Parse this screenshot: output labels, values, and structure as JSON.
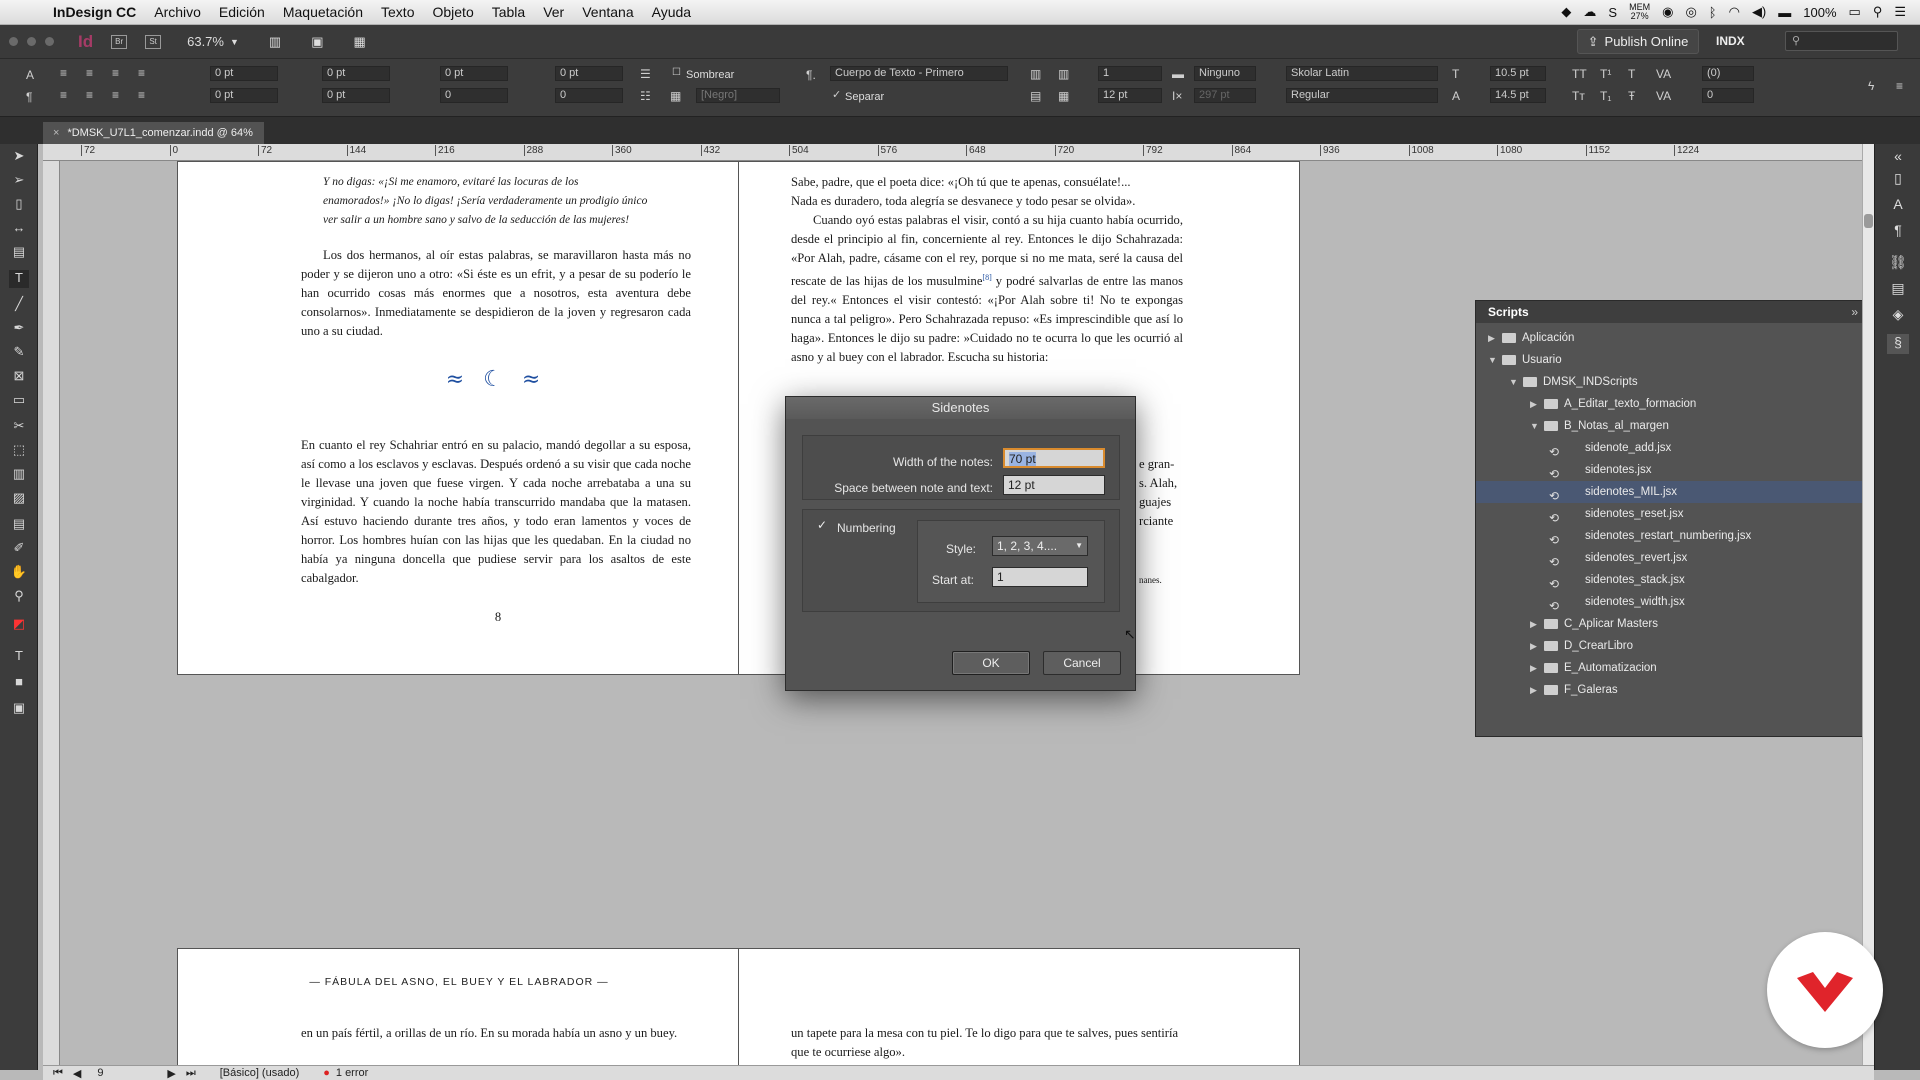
{
  "menubar": {
    "app": "InDesign CC",
    "items": [
      "Archivo",
      "Edición",
      "Maquetación",
      "Texto",
      "Objeto",
      "Tabla",
      "Ver",
      "Ventana",
      "Ayuda"
    ],
    "mem_top": "MEM",
    "mem_val": "27%",
    "battery": "100%"
  },
  "appbar": {
    "logo": "Id",
    "br": "Br",
    "st": "St",
    "zoom": "63.7%",
    "publish": "Publish Online",
    "workspace": "INDX"
  },
  "control": {
    "pt": "0 pt",
    "zero": "0",
    "shade": "Sombrear",
    "separate": "Separar",
    "black": "[Negro]",
    "para_style": "Cuerpo de Texto - Primero",
    "one": "1",
    "twelve": "12 pt",
    "none": "Ninguno",
    "width_disabled": "297 pt",
    "font": "Skolar Latin",
    "weight": "Regular",
    "size": "10.5 pt",
    "leading": "14.5 pt",
    "kern": "(0)"
  },
  "doc": {
    "tab": "*DMSK_U7L1_comenzar.indd @ 64%"
  },
  "ruler": [
    "72",
    "0",
    "72",
    "144",
    "216",
    "288",
    "360",
    "432",
    "504",
    "576",
    "648",
    "720",
    "792",
    "864",
    "936",
    "1008",
    "1080",
    "1152",
    "1224"
  ],
  "left_page": {
    "poem": [
      "Y no digas: «¡Si me enamoro, evitaré las locuras de los",
      "enamorados!» ¡No lo digas! ¡Sería verdaderamente un prodigio único",
      "ver salir a un hombre sano y salvo de la seducción de las mujeres!"
    ],
    "para1": "Los dos hermanos, al oír estas palabras, se maravillaron hasta más no poder y se dijeron uno a otro: «Si éste es un efrit, y a pesar de su poderío le han ocurrido cosas más enormes que a nosotros, esta aventura debe consolarnos». Inmediatamente se despidieron de la joven y regresaron cada uno a su ciudad.",
    "ornament": "≈  ☾  ≈",
    "para2": "En cuanto el rey Schahriar entró en su palacio, mandó degollar a su esposa, así como a los esclavos y esclavas. Después ordenó a su visir que cada noche le llevase una joven que fuese virgen. Y cada noche arrebataba a una su virginidad. Y cuando la noche había transcurrido mandaba que la matasen. Así estuvo haciendo durante tres años, y todo eran lamentos y voces de horror. Los hombres huían con las hijas que les quedaban. En la ciudad no había ya ninguna doncella que pudiese servir para los asaltos de este cabalgador.",
    "page_num": "8"
  },
  "right_page": {
    "line1": "Sabe, padre, que el poeta dice: «¡Oh tú que te apenas, consuélate!...",
    "line2": "Nada es duradero, toda alegría se desvanece y todo pesar se olvida».",
    "para": "Cuando oyó estas palabras el visir, contó a su hija cuanto había ocurrido, desde el principio al fin, concerniente al rey. Entonces le dijo Schahrazada: «Por Alah, padre, cásame con el rey, porque si no me mata, seré la causa del rescate de las hijas de los musulmine",
    "footref": "[8]",
    "para_rest": " y podré salvarlas de entre las manos del rey.« Entonces el visir contestó: «¡Por Alah sobre ti! No te expongas nunca a tal peligro». Pero Schahrazada repuso: «Es imprescindible que así lo haga». Entonces le dijo su padre: »Cuidado no te ocurra lo que les ocurrió al asno y al buey con el labrador. Escucha su historia:",
    "frag1": "e gran-",
    "frag2": "s. Alah,",
    "frag3": "guajes",
    "frag4": "rciante",
    "frag5": "nanes."
  },
  "lower_spread": {
    "heading": "— FÁBULA DEL ASNO, EL BUEY Y EL LABRADOR —",
    "left_text": "en un país fértil, a orillas de un río. En su morada había un asno y un buey.",
    "right_text": "un tapete para la mesa con tu piel. Te lo digo para que te salves, pues sentiría que te ocurriese algo»."
  },
  "dialog": {
    "title": "Sidenotes",
    "width_label": "Width of the notes:",
    "width_value": "70 pt",
    "space_label": "Space between note and text:",
    "space_value": "12 pt",
    "numbering_label": "Numbering",
    "numbering_checked": true,
    "style_label": "Style:",
    "style_value": "1, 2, 3, 4....",
    "start_label": "Start at:",
    "start_value": "1",
    "ok": "OK",
    "cancel": "Cancel"
  },
  "scripts_panel": {
    "title": "Scripts",
    "items": [
      {
        "label": "Aplicación",
        "type": "folder",
        "level": 0,
        "open": false
      },
      {
        "label": "Usuario",
        "type": "folder",
        "level": 0,
        "open": true
      },
      {
        "label": "DMSK_INDScripts",
        "type": "folder",
        "level": 1,
        "open": true
      },
      {
        "label": "A_Editar_texto_formacion",
        "type": "folder",
        "level": 2,
        "open": false
      },
      {
        "label": "B_Notas_al_margen",
        "type": "folder",
        "level": 2,
        "open": true
      },
      {
        "label": "sidenote_add.jsx",
        "type": "script",
        "level": 3
      },
      {
        "label": "sidenotes.jsx",
        "type": "script",
        "level": 3
      },
      {
        "label": "sidenotes_MIL.jsx",
        "type": "script",
        "level": 3,
        "selected": true
      },
      {
        "label": "sidenotes_reset.jsx",
        "type": "script",
        "level": 3
      },
      {
        "label": "sidenotes_restart_numbering.jsx",
        "type": "script",
        "level": 3
      },
      {
        "label": "sidenotes_revert.jsx",
        "type": "script",
        "level": 3
      },
      {
        "label": "sidenotes_stack.jsx",
        "type": "script",
        "level": 3
      },
      {
        "label": "sidenotes_width.jsx",
        "type": "script",
        "level": 3
      },
      {
        "label": "C_Aplicar Masters",
        "type": "folder",
        "level": 2,
        "open": false
      },
      {
        "label": "D_CrearLibro",
        "type": "folder",
        "level": 2,
        "open": false
      },
      {
        "label": "E_Automatizacion",
        "type": "folder",
        "level": 2,
        "open": false
      },
      {
        "label": "F_Galeras",
        "type": "folder",
        "level": 2,
        "open": false
      }
    ]
  },
  "statusbar": {
    "page": "9",
    "master": "[Básico] (usado)",
    "errors": "1 error"
  },
  "colors": {
    "accent_selection": "#4a5873",
    "logo_red": "#e0242b",
    "ornament_blue": "#1f4fa0"
  }
}
